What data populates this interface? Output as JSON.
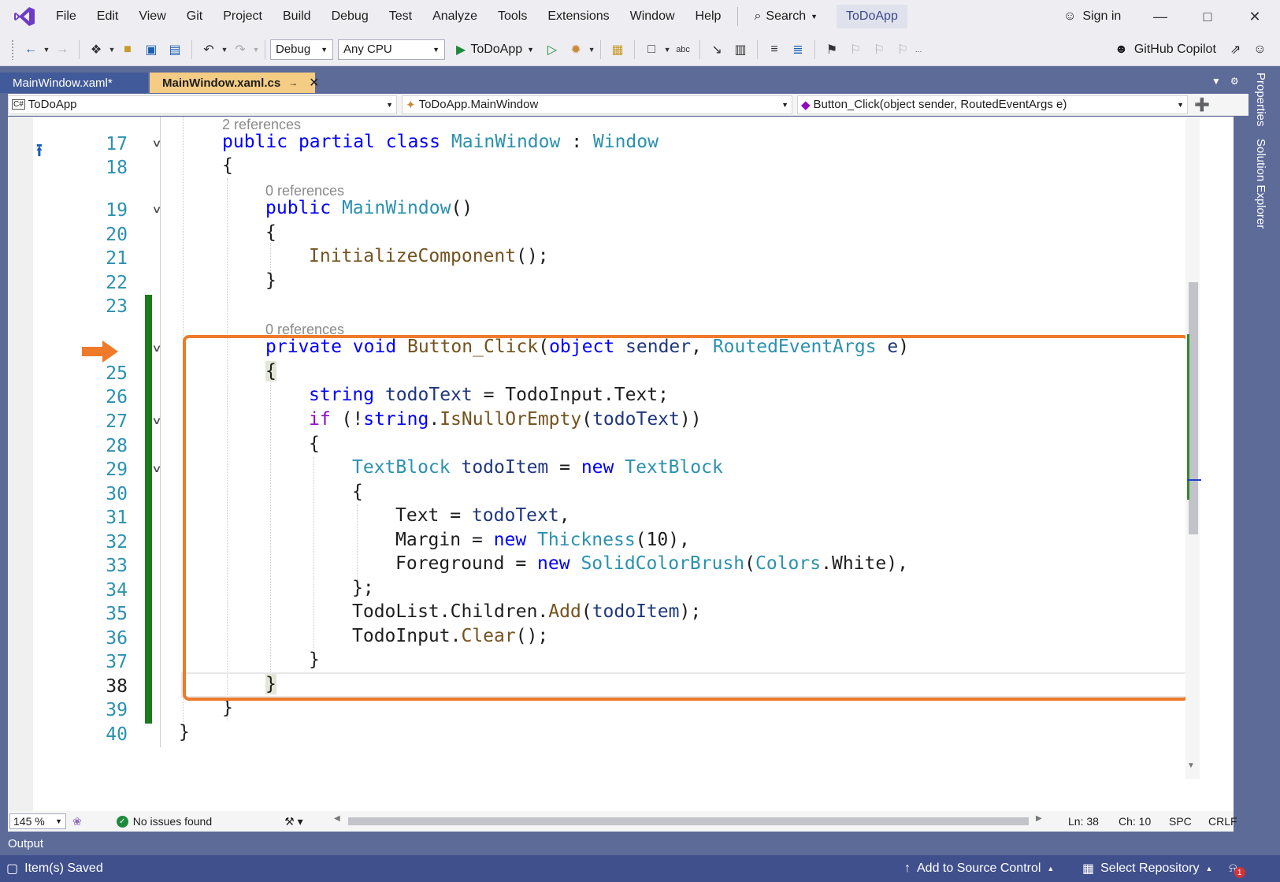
{
  "menubar": {
    "items": [
      "File",
      "Edit",
      "View",
      "Git",
      "Project",
      "Build",
      "Debug",
      "Test",
      "Analyze",
      "Tools",
      "Extensions",
      "Window",
      "Help"
    ],
    "search_label": "Search",
    "app_name": "ToDoApp",
    "signin_label": "Sign in"
  },
  "toolbar": {
    "config": "Debug",
    "platform": "Any CPU",
    "run_target": "ToDoApp",
    "copilot_label": "GitHub Copilot"
  },
  "tabs": [
    {
      "label": "MainWindow.xaml*",
      "active": false
    },
    {
      "label": "MainWindow.xaml.cs",
      "active": true
    }
  ],
  "navbar": {
    "project": "ToDoApp",
    "type": "ToDoApp.MainWindow",
    "member": "Button_Click(object sender, RoutedEventArgs e)"
  },
  "code": {
    "line_numbers": [
      "17",
      "18",
      "19",
      "20",
      "21",
      "22",
      "23",
      "",
      "25",
      "26",
      "27",
      "28",
      "29",
      "30",
      "31",
      "32",
      "33",
      "34",
      "35",
      "36",
      "37",
      "38",
      "39",
      "40"
    ],
    "lens_2_refs": "2 references",
    "lens_0_refs_a": "0 references",
    "lens_0_refs_b": "0 references"
  },
  "status": {
    "zoom": "145 %",
    "issues": "No issues found",
    "line": "Ln: 38",
    "col": "Ch: 10",
    "indent": "SPC",
    "eol": "CRLF",
    "output_label": "Output",
    "saved_text": "Item(s) Saved",
    "source_control": "Add to Source Control",
    "repository": "Select Repository",
    "notifications": "1"
  },
  "side_tabs": [
    "Properties",
    "Solution Explorer"
  ],
  "colors": {
    "highlight_box": "#ee7a2a",
    "active_tab": "#f5cc84",
    "status_bar": "#40508d",
    "change_bar": "#1b7a1b"
  }
}
